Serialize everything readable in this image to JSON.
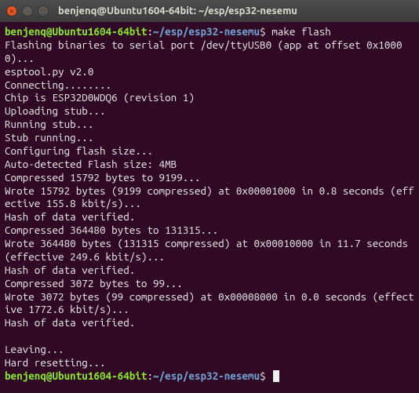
{
  "window": {
    "title": "benjenq@Ubuntu1604-64bit: ~/esp/esp32-nesemu"
  },
  "prompt1": {
    "user_host": "benjenq@Ubuntu1604-64bit",
    "colon": ":",
    "path": "~/esp/esp32-nesemu",
    "dollar": "$",
    "command": "make flash"
  },
  "lines": [
    "Flashing binaries to serial port /dev/ttyUSB0 (app at offset 0x10000)...",
    "esptool.py v2.0",
    "Connecting........",
    "Chip is ESP32D0WDQ6 (revision 1)",
    "Uploading stub...",
    "Running stub...",
    "Stub running...",
    "Configuring flash size...",
    "Auto-detected Flash size: 4MB",
    "Compressed 15792 bytes to 9199...",
    "Wrote 15792 bytes (9199 compressed) at 0x00001000 in 0.8 seconds (effective 155.8 kbit/s)...",
    "Hash of data verified.",
    "Compressed 364480 bytes to 131315...",
    "Wrote 364480 bytes (131315 compressed) at 0x00010000 in 11.7 seconds (effective 249.6 kbit/s)...",
    "Hash of data verified.",
    "Compressed 3072 bytes to 99...",
    "Wrote 3072 bytes (99 compressed) at 0x00008000 in 0.0 seconds (effective 1772.6 kbit/s)...",
    "Hash of data verified.",
    "",
    "Leaving...",
    "Hard resetting..."
  ],
  "prompt2": {
    "user_host": "benjenq@Ubuntu1604-64bit",
    "colon": ":",
    "path": "~/esp/esp32-nesemu",
    "dollar": "$"
  }
}
